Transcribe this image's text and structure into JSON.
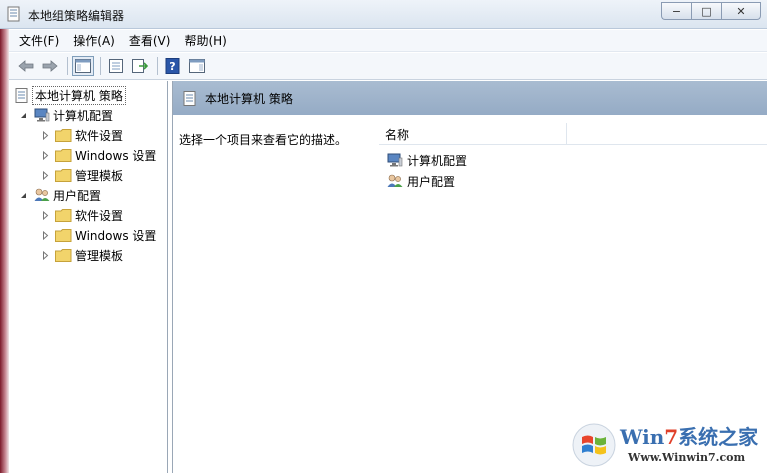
{
  "window": {
    "title": "本地组策略编辑器",
    "minimize_glyph": "−",
    "maximize_glyph": "□",
    "close_glyph": "✕"
  },
  "menu": {
    "items": [
      "文件(F)",
      "操作(A)",
      "查看(V)",
      "帮助(H)"
    ]
  },
  "toolbar": {
    "icons": [
      "back-arrow-icon",
      "forward-arrow-icon",
      "show-tree-icon",
      "properties-icon",
      "export-list-icon",
      "help-icon",
      "show-action-pane-icon"
    ]
  },
  "tree": {
    "root": "本地计算机 策略",
    "computer_config": "计算机配置",
    "user_config": "用户配置",
    "computer_children": [
      "软件设置",
      "Windows 设置",
      "管理模板"
    ],
    "user_children": [
      "软件设置",
      "Windows 设置",
      "管理模板"
    ]
  },
  "right": {
    "header_title": "本地计算机 策略",
    "description": "选择一个项目来查看它的描述。",
    "column_name": "名称",
    "items": [
      "计算机配置",
      "用户配置"
    ]
  },
  "watermark": {
    "brand_prefix": "Win",
    "brand_seven": "7",
    "brand_suffix": "系统之家",
    "url": "Www.Winwin7.com"
  },
  "colors": {
    "header_blue": "#9fb4cc",
    "folder_yellow": "#f2d46b",
    "stripe_red": "#7c1a2a"
  }
}
